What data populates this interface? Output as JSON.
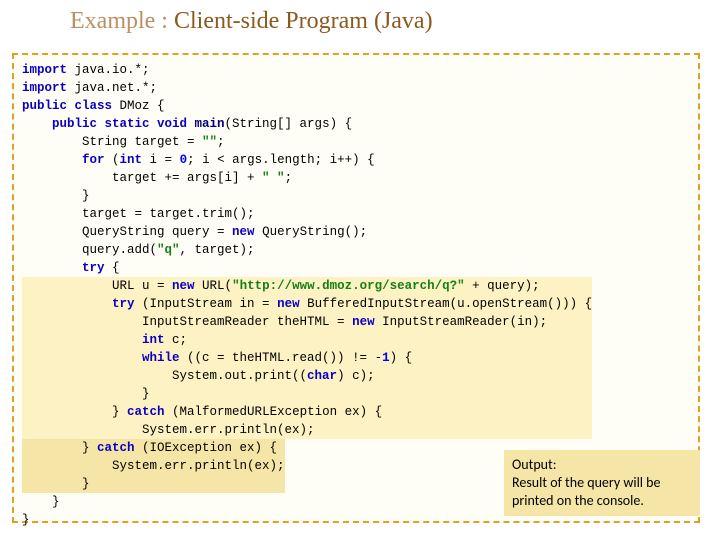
{
  "title": {
    "prefix": "Example : ",
    "main": "Client-side Program (Java)"
  },
  "code": {
    "l01a": "import",
    "l01b": " java.io.*;",
    "l02a": "import",
    "l02b": " java.net.*;",
    "l03a": "public class ",
    "l03b": "DMoz {",
    "l04a": "    public static void ",
    "l04b": "main",
    "l04c": "(String[] args) {",
    "l05a": "        String target = ",
    "l05q": "\"\"",
    "l05b": ";",
    "l06a": "        for",
    "l06b": " (",
    "l06c": "int",
    "l06d": " i = ",
    "l06e": "0",
    "l06f": "; i < args.length; i++) {",
    "l07a": "            target += args[i] + ",
    "l07q": "\" \"",
    "l07b": ";",
    "l08": "        }",
    "l09": "        target = target.trim();",
    "l10": "        QueryString query = ",
    "l10b": "new",
    "l10c": " QueryString();",
    "l11": "        query.add(",
    "l11q": "\"q\"",
    "l11b": ", target);",
    "l12a": "        try",
    "l12b": " {",
    "l13a": "            URL u = ",
    "l13b": "new",
    "l13c": " URL(",
    "l13q": "\"http://www.dmoz.org/search/q?\"",
    "l13d": " + query);",
    "l14a": "            try",
    "l14b": " (InputStream in = ",
    "l14c": "new",
    "l14d": " BufferedInputStream(u.openStream())) {",
    "l15a": "                InputStreamReader theHTML = ",
    "l15b": "new",
    "l15c": " InputStreamReader(in);",
    "l16a": "                int",
    "l16b": " c;",
    "l17a": "                while",
    "l17b": " ((c = theHTML.read()) != -",
    "l17n": "1",
    "l17c": ") {",
    "l18a": "                    System.out.print((",
    "l18b": "char",
    "l18c": ") c);",
    "l19": "                }",
    "l20a": "            } ",
    "l20b": "catch",
    "l20c": " (MalformedURLException ex) {",
    "l21": "                System.err.println(ex);",
    "l22a": "        } ",
    "l22b": "catch",
    "l22c": " (IOException ex) {",
    "l23": "            System.err.println(ex);",
    "l24": "        }",
    "l25": "    }",
    "l26": "}"
  },
  "note": {
    "line1": "Output:",
    "line2": "Result of the query will be printed on the console."
  }
}
